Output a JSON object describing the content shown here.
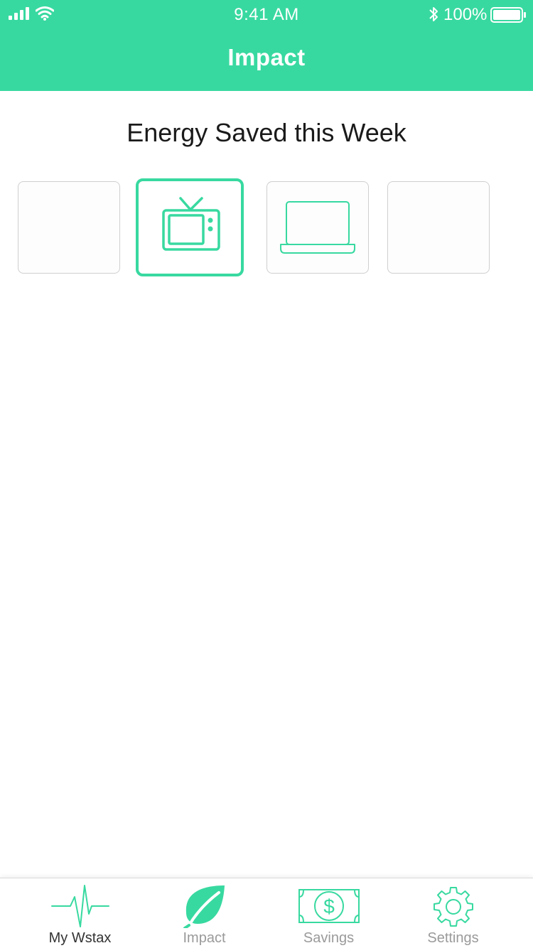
{
  "status_bar": {
    "time": "9:41 AM",
    "battery_percent": "100%",
    "icons": [
      "signal-icon",
      "wifi-icon",
      "bluetooth-icon",
      "battery-icon"
    ]
  },
  "header": {
    "title": "Impact",
    "background_color": "#38d9a0"
  },
  "main": {
    "section_title": "Energy Saved this Week",
    "devices": [
      {
        "icon": "none",
        "selected": false
      },
      {
        "icon": "tv-icon",
        "selected": true
      },
      {
        "icon": "laptop-icon",
        "selected": false
      },
      {
        "icon": "none",
        "selected": false
      }
    ]
  },
  "tab_bar": {
    "active_tab": "My Wstax",
    "tabs": [
      {
        "label": "My Wstax",
        "icon": "heartbeat-icon"
      },
      {
        "label": "Impact",
        "icon": "leaf-icon"
      },
      {
        "label": "Savings",
        "icon": "dollar-bill-icon"
      },
      {
        "label": "Settings",
        "icon": "gear-icon"
      }
    ]
  },
  "colors": {
    "accent": "#38d9a0",
    "tile_border": "#cfcfcf",
    "tab_label": "#9a9a9a",
    "tab_label_active": "#333333"
  }
}
